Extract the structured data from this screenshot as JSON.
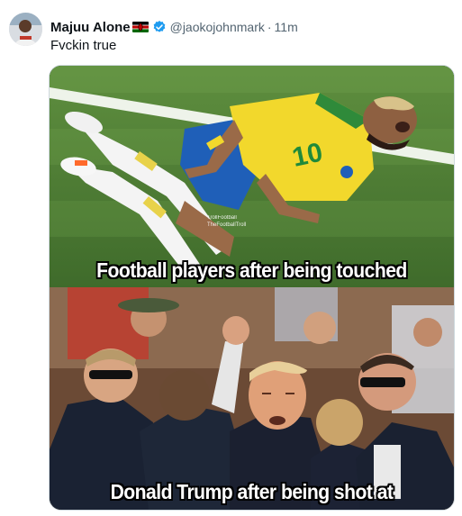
{
  "tweet": {
    "display_name": "Majuu Alone",
    "handle": "@jaokojohnmark",
    "separator": "·",
    "time": "11m",
    "text": "Fvckin true",
    "avatar_icon": "avatar-icon",
    "flag_icon": "kenya-flag-icon",
    "verified_icon": "verified-badge-icon",
    "verified_color": "#1d9bf0"
  },
  "media": {
    "top_caption": "Football players after being touched",
    "bottom_caption": "Donald Trump after being shot at",
    "watermark_lines": [
      "TrollFootball",
      "TheFootballTroll"
    ]
  }
}
